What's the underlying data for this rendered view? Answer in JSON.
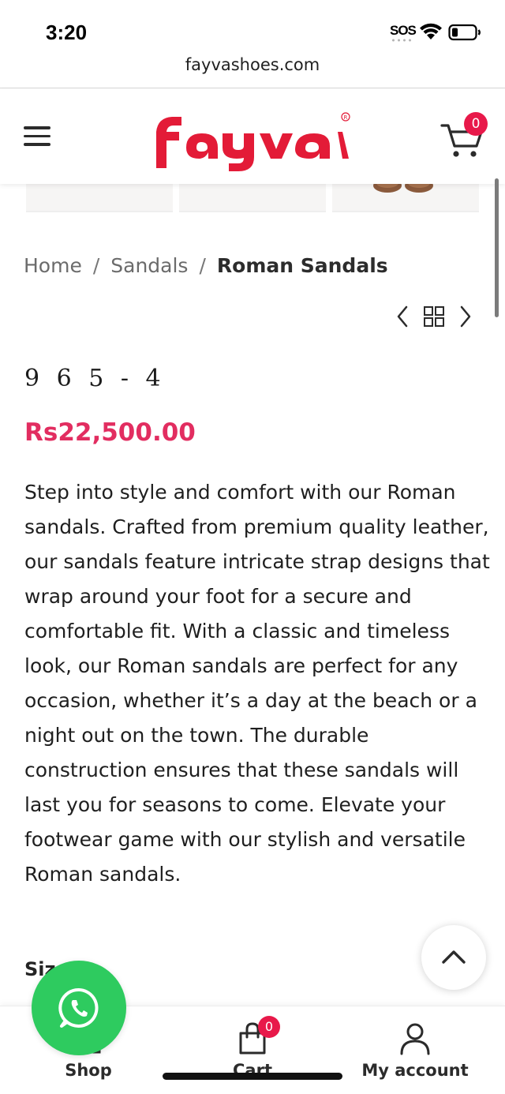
{
  "status_bar": {
    "time": "3:20",
    "sos": "SOS"
  },
  "browser": {
    "url": "fayvashoes.com"
  },
  "header": {
    "logo_text": "fayva",
    "cart_count": "0"
  },
  "breadcrumb": {
    "items": [
      "Home",
      "Sandals",
      "Roman Sandals"
    ],
    "separator": "/"
  },
  "product": {
    "title": "9 6 5 - 4",
    "price": "Rs22,500.00",
    "description": "Step into style and comfort with our Roman sandals. Crafted from premium quality leather, our sandals feature intricate strap designs that wrap around your foot for a secure and comfortable fit. With a classic and timeless look, our Roman sandals are perfect for any occasion, whether it’s a day at the beach or a night out on the town. The durable construction ensures that these sandals will last you for seasons to come. Elevate your footwear game with our stylish and versatile Roman sandals.",
    "size_label": "Size"
  },
  "bottom_nav": {
    "items": [
      {
        "label": "Shop",
        "icon": "shop-icon"
      },
      {
        "label": "Cart",
        "icon": "cart-icon",
        "badge": "0"
      },
      {
        "label": "My account",
        "icon": "user-icon"
      }
    ]
  },
  "colors": {
    "brand_red": "#e31b37",
    "price": "#e22d60",
    "badge": "#e8194a",
    "whatsapp": "#2ecb5f"
  }
}
